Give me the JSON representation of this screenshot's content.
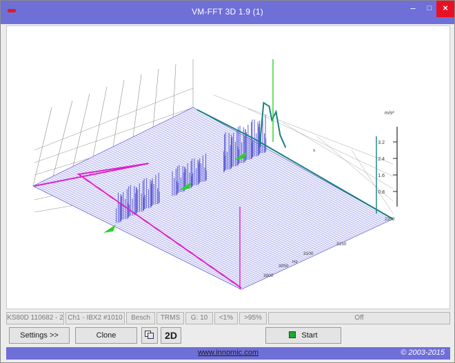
{
  "window": {
    "title": "VM-FFT 3D 1.9 (1)",
    "minimize_glyph": "–",
    "maximize_glyph": "□",
    "close_glyph": "×"
  },
  "plot": {
    "z_unit": "m/s²",
    "z_ticks": [
      "3.2",
      "2.4",
      "1.6",
      "0.8"
    ],
    "freq_label": "Hz",
    "freq_ticks": [
      "2250",
      "3150",
      "3100",
      "3050",
      "3000"
    ],
    "time_label": "s",
    "colors": {
      "mesh": "#5a5ad2",
      "mesh_light": "#9c9ce6",
      "pink_marker": "#e020c8",
      "teal_marker": "#188080",
      "green_marker": "#2ad12a",
      "wall_lines": "#8a8a8a"
    }
  },
  "status": {
    "cells": [
      "KS80D 110682 - 2",
      "Ch1 - IBX2 #1010",
      "Besch",
      "TRMS",
      "G: 10",
      "<1%",
      ">95%",
      "Off"
    ]
  },
  "toolbar": {
    "settings_label": "Settings >>",
    "clone_label": "Clone",
    "copy_icon": "copy-icon",
    "twod_label": "2D",
    "start_label": "Start"
  },
  "footer": {
    "link": "www.innomic.com",
    "copyright": "© 2003-2015"
  }
}
